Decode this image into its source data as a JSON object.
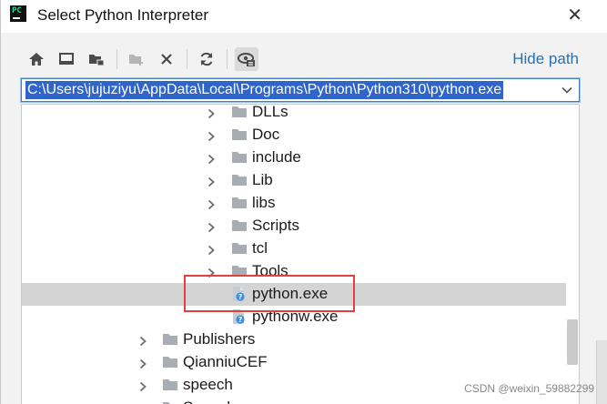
{
  "window": {
    "title": "Select Python Interpreter",
    "close_glyph": "✕"
  },
  "toolbar": {
    "buttons": [
      "home-icon",
      "desktop-icon",
      "project-folder-icon",
      "new-folder-icon",
      "delete-icon",
      "refresh-icon",
      "show-hidden-icon"
    ],
    "hide_path_label": "Hide path"
  },
  "path_field": {
    "value": "C:\\Users\\jujuziyu\\AppData\\Local\\Programs\\Python\\Python310\\python.exe"
  },
  "tree": {
    "items": [
      {
        "label": "DLLs",
        "type": "folder"
      },
      {
        "label": "Doc",
        "type": "folder"
      },
      {
        "label": "include",
        "type": "folder"
      },
      {
        "label": "Lib",
        "type": "folder"
      },
      {
        "label": "libs",
        "type": "folder"
      },
      {
        "label": "Scripts",
        "type": "folder"
      },
      {
        "label": "tcl",
        "type": "folder"
      },
      {
        "label": "Tools",
        "type": "folder"
      },
      {
        "label": "python.exe",
        "type": "file",
        "selected": true
      },
      {
        "label": "pythonw.exe",
        "type": "file"
      },
      {
        "label": "Publishers",
        "type": "folder"
      },
      {
        "label": "QianniuCEF",
        "type": "folder"
      },
      {
        "label": "speech",
        "type": "folder"
      },
      {
        "label": "Speech",
        "type": "folder"
      }
    ]
  },
  "watermark": "CSDN @weixin_59882299",
  "colors": {
    "selection": "#2f65ca",
    "link": "#2470b3",
    "highlight_box": "#e0413f",
    "selected_row": "#d4d4d4"
  }
}
